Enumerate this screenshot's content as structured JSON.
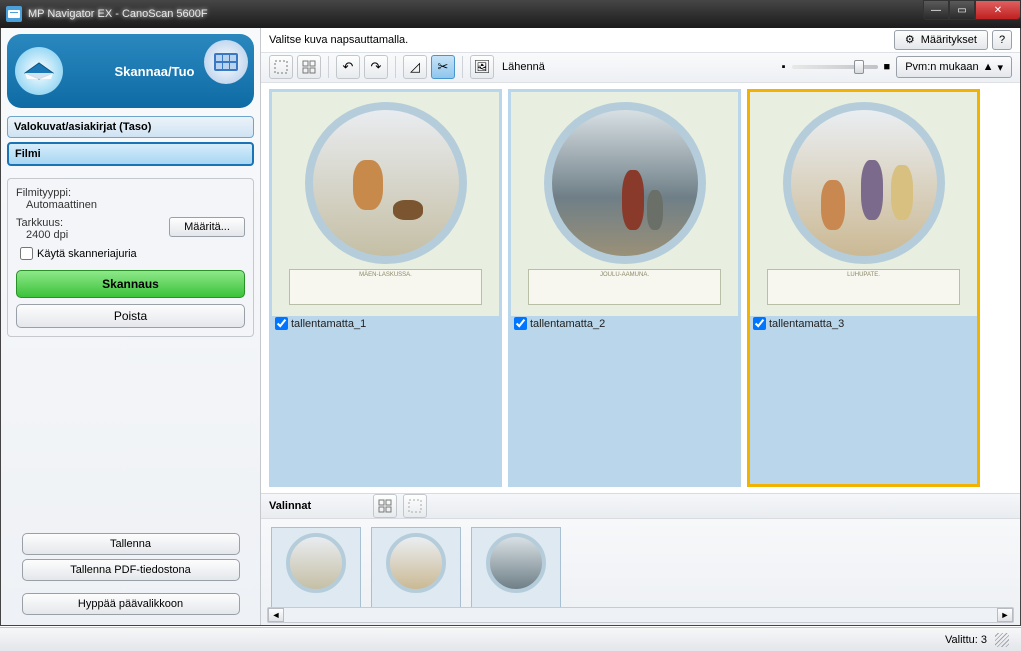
{
  "window": {
    "title": "MP Navigator EX - CanoScan 5600F"
  },
  "sidebar": {
    "header": "Skannaa/Tuo",
    "items": [
      "Valokuvat/asiakirjat (Taso)",
      "Filmi"
    ],
    "settings": {
      "film_type_label": "Filmityyppi:",
      "film_type_value": "Automaattinen",
      "resolution_label": "Tarkkuus:",
      "resolution_value": "2400 dpi",
      "configure_button": "Määritä...",
      "use_driver_checkbox": "Käytä skanneriajuria"
    },
    "scan_button": "Skannaus",
    "delete_button": "Poista",
    "save_button": "Tallenna",
    "save_pdf_button": "Tallenna PDF-tiedostona",
    "main_menu_button": "Hyppää päävalikkoon"
  },
  "toolbar": {
    "instruction": "Valitse kuva napsauttamalla.",
    "settings_button": "Määritykset",
    "help_button": "?",
    "zoom_label": "Lähennä",
    "sort_label": "Pvm:n mukaan"
  },
  "thumbs": [
    {
      "name": "tallentamatta_1",
      "checked": true,
      "caption_title": "MÄEN-LASKUSSA."
    },
    {
      "name": "tallentamatta_2",
      "checked": true,
      "caption_title": "JOULU-AAMUNA."
    },
    {
      "name": "tallentamatta_3",
      "checked": true,
      "caption_title": "LUHUPATE.",
      "selected": true
    }
  ],
  "selection": {
    "title": "Valinnat"
  },
  "status": {
    "selected_label": "Valittu: 3"
  }
}
